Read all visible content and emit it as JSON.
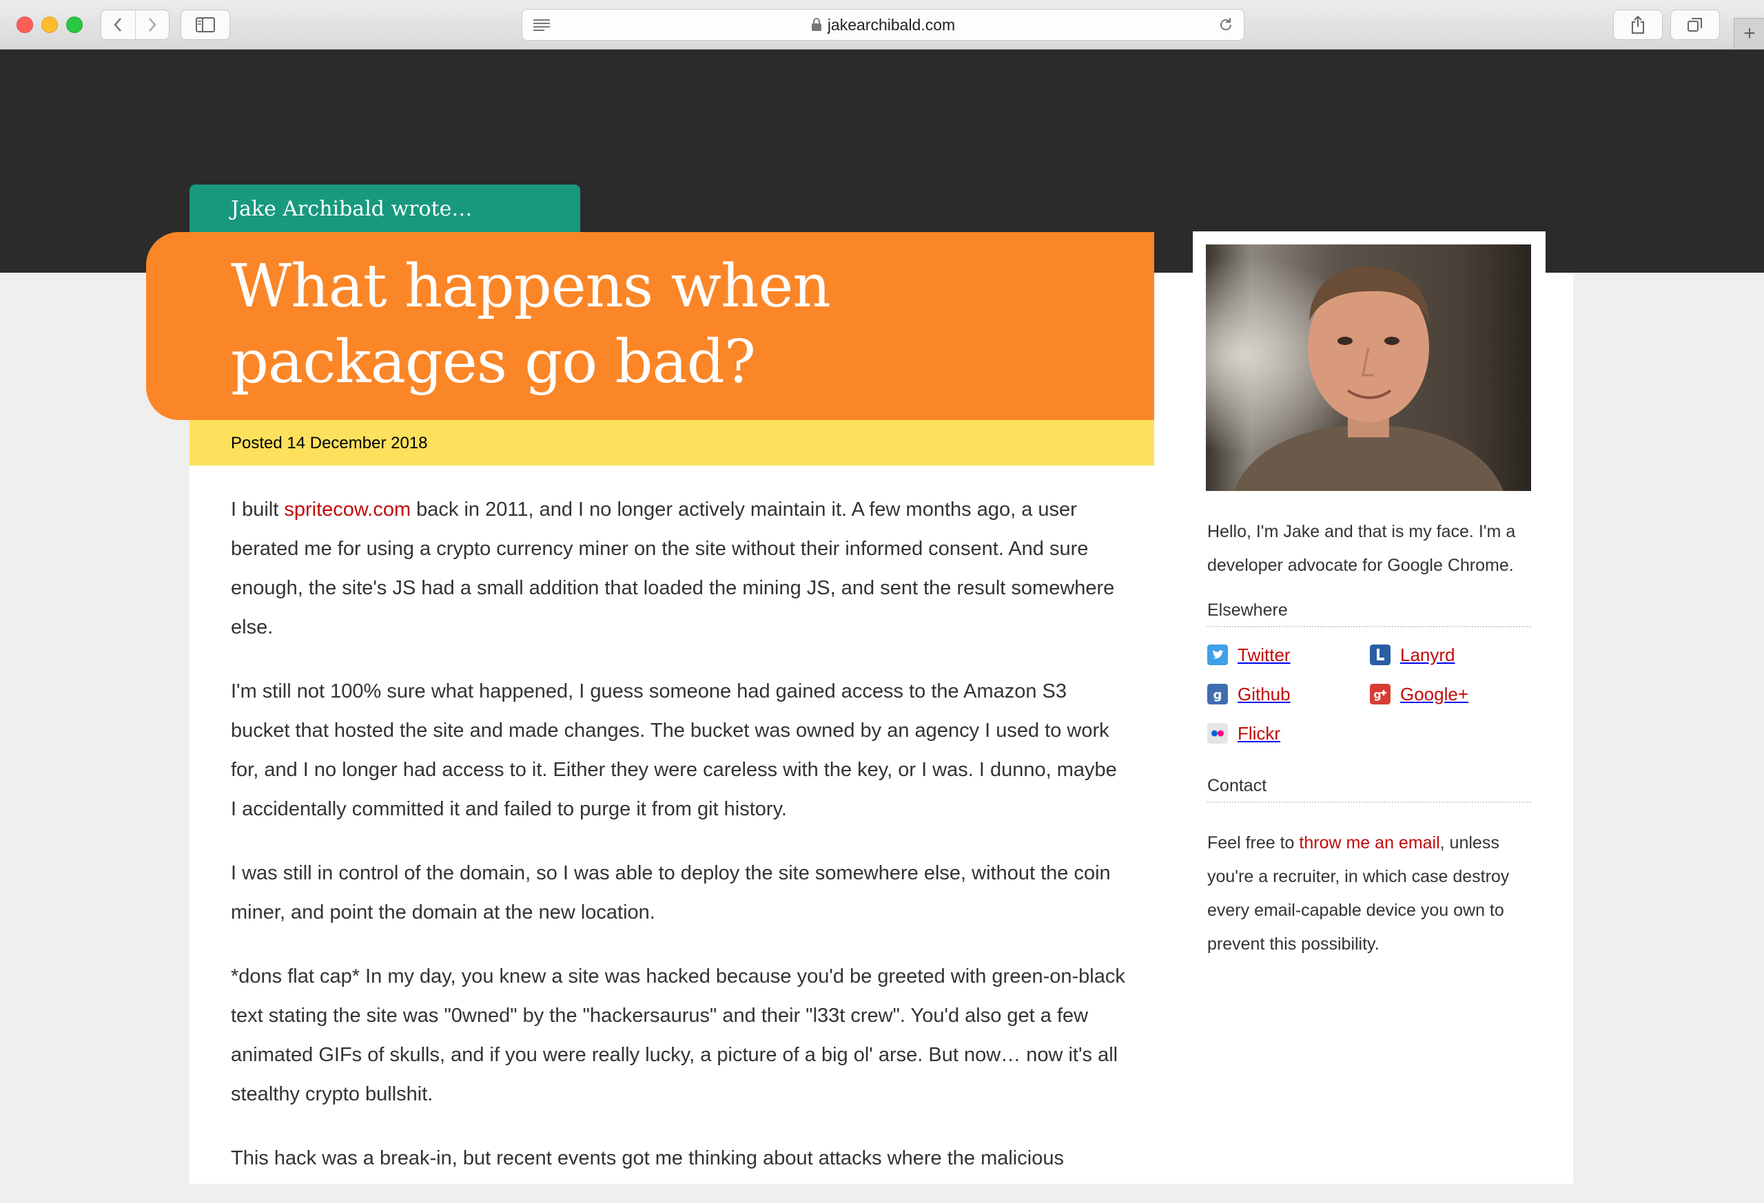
{
  "browser": {
    "url": "jakearchibald.com"
  },
  "post": {
    "author_tab": "Jake Archibald wrote…",
    "title_line1": "What happens when",
    "title_line2": "packages go bad?",
    "posted": "Posted 14 December 2018",
    "p1": {
      "before": "I built ",
      "link": "spritecow.com",
      "after": " back in 2011, and I no longer actively maintain it. A few months ago, a user berated me for using a crypto currency miner on the site without their informed consent. And sure enough, the site's JS had a small addition that loaded the mining JS, and sent the result somewhere else."
    },
    "p2": "I'm still not 100% sure what happened, I guess someone had gained access to the Amazon S3 bucket that hosted the site and made changes. The bucket was owned by an agency I used to work for, and I no longer had access to it. Either they were careless with the key, or I was. I dunno, maybe I accidentally committed it and failed to purge it from git history.",
    "p3": "I was still in control of the domain, so I was able to deploy the site somewhere else, without the coin miner, and point the domain at the new location.",
    "p4": "*dons flat cap* In my day, you knew a site was hacked because you'd be greeted with green-on-black text stating the site was \"0wned\" by the \"hackersaurus\" and their \"l33t crew\". You'd also get a few animated GIFs of skulls, and if you were really lucky, a picture of a big ol' arse. But now… now it's all stealthy crypto bullshit.",
    "p5": "This hack was a break-in, but recent events got me thinking about attacks where the malicious"
  },
  "sidebar": {
    "bio": "Hello, I'm Jake and that is my face. I'm a developer advocate for Google Chrome.",
    "elsewhere_heading": "Elsewhere",
    "links": [
      {
        "label": "Twitter",
        "icon": "twitter-icon",
        "color": "#1da1f2"
      },
      {
        "label": "Lanyrd",
        "icon": "lanyrd-icon",
        "color": "#2a5ea5"
      },
      {
        "label": "Github",
        "icon": "github-icon",
        "color": "#3f6fb0"
      },
      {
        "label": "Google+",
        "icon": "google-plus-icon",
        "color": "#d73d32"
      },
      {
        "label": "Flickr",
        "icon": "flickr-icon",
        "color": "#e5e5e5"
      }
    ],
    "contact_heading": "Contact",
    "contact_before": "Feel free to ",
    "contact_link": "throw me an email",
    "contact_after": ", unless you're a recruiter, in which case destroy every email-capable device you own to prevent this possibility."
  },
  "colors": {
    "accent_orange": "#fb8628",
    "accent_teal": "#18997e",
    "accent_yellow": "#fde15d",
    "link_red": "#c10a0a",
    "header_dark": "#2b2b2b"
  }
}
